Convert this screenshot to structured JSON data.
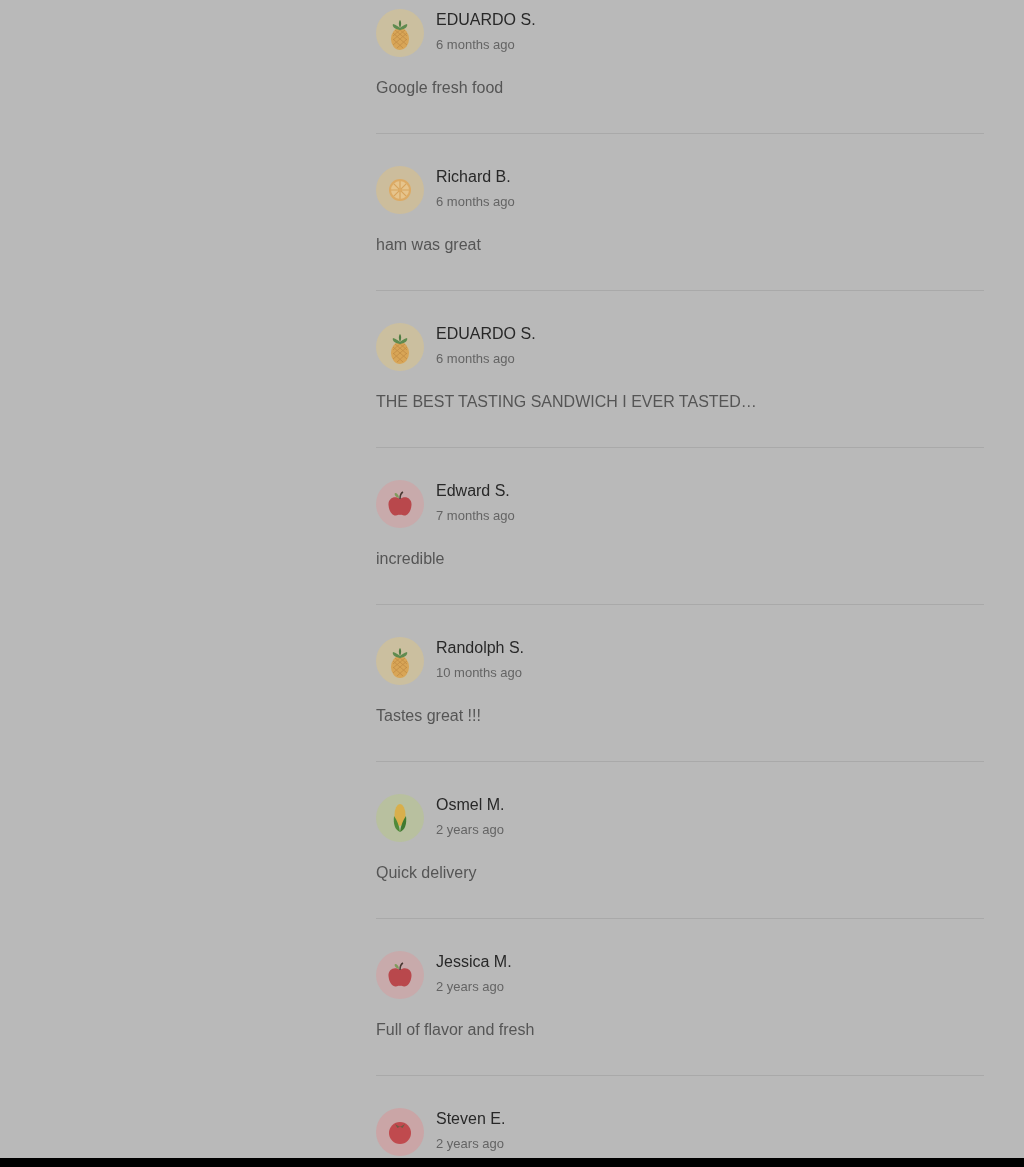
{
  "reviews": [
    {
      "avatar": {
        "kind": "pineapple"
      },
      "name": "EDUARDO S.",
      "time": "6 months ago",
      "comment": "Google fresh food"
    },
    {
      "avatar": {
        "kind": "orange"
      },
      "name": "Richard B.",
      "time": "6 months ago",
      "comment": "ham was great"
    },
    {
      "avatar": {
        "kind": "pineapple"
      },
      "name": "EDUARDO S.",
      "time": "6 months ago",
      "comment": "THE BEST TASTING SANDWICH I EVER TASTED…"
    },
    {
      "avatar": {
        "kind": "apple"
      },
      "name": "Edward S.",
      "time": "7 months ago",
      "comment": "incredible"
    },
    {
      "avatar": {
        "kind": "pineapple"
      },
      "name": "Randolph S.",
      "time": "10 months ago",
      "comment": "Tastes great !!!"
    },
    {
      "avatar": {
        "kind": "corn"
      },
      "name": "Osmel M.",
      "time": "2 years ago",
      "comment": "Quick delivery"
    },
    {
      "avatar": {
        "kind": "apple"
      },
      "name": "Jessica M.",
      "time": "2 years ago",
      "comment": "Full of flavor and fresh"
    },
    {
      "avatar": {
        "kind": "tomato"
      },
      "name": "Steven E.",
      "time": "2 years ago"
    }
  ]
}
